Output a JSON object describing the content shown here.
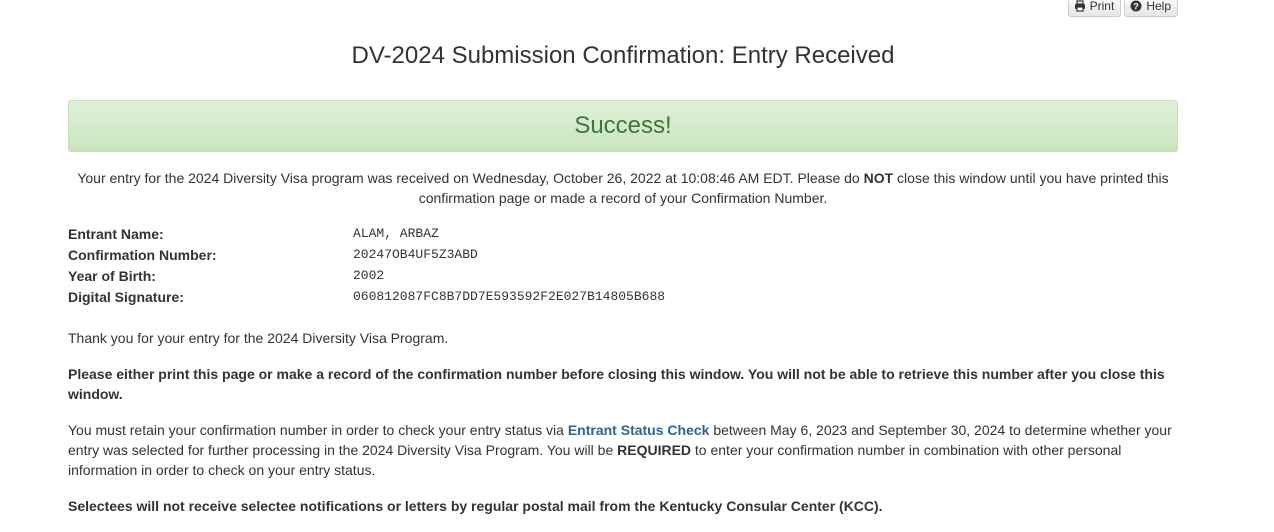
{
  "toolbar": {
    "print_label": "Print",
    "help_label": "Help"
  },
  "page": {
    "title": "DV-2024 Submission Confirmation: Entry Received"
  },
  "alert": {
    "text": "Success!"
  },
  "received": {
    "part1": "Your entry for the 2024 Diversity Visa program was received on Wednesday, October 26, 2022 at 10:08:46 AM EDT. Please do ",
    "emphasis": "NOT",
    "part2": " close this window until you have printed this confirmation page or made a record of your Confirmation Number."
  },
  "details": {
    "entrant_name_label": "Entrant Name:",
    "entrant_name_value": "ALAM, ARBAZ",
    "confirmation_label": "Confirmation Number:",
    "confirmation_value": "20247OB4UF5Z3ABD",
    "birth_year_label": "Year of Birth:",
    "birth_year_value": "2002",
    "signature_label": "Digital Signature:",
    "signature_value": "060812087FC8B7DD7E593592F2E027B14805B688"
  },
  "body": {
    "thank_you": "Thank you for your entry for the 2024 Diversity Visa Program.",
    "print_warning": "Please either print this page or make a record of the confirmation number before closing this window. You will not be able to retrieve this number after you close this window.",
    "retain_part1": "You must retain your confirmation number in order to check your entry status via ",
    "status_check_link": "Entrant Status Check",
    "retain_part2": " between May 6, 2023 and September 30, 2024 to determine whether your entry was selected for further processing in the 2024 Diversity Visa Program. You will be ",
    "required": "REQUIRED",
    "retain_part3": " to enter your confirmation number in combination with other personal information in order to check on your entry status.",
    "selectees_notice": "Selectees will not receive selectee notifications or letters by regular postal mail from the Kentucky Consular Center (KCC)."
  }
}
